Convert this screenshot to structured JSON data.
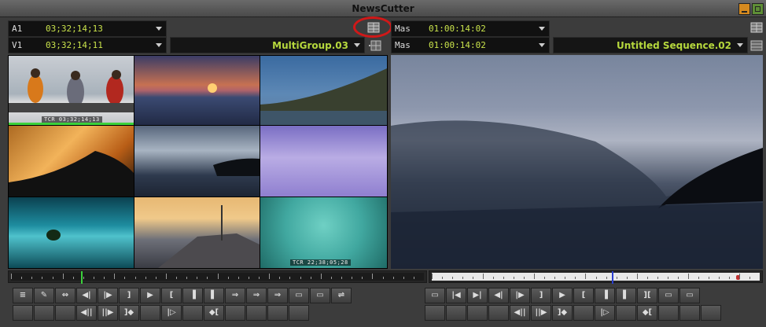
{
  "window": {
    "title": "NewsCutter"
  },
  "source": {
    "track_a": {
      "label": "A1",
      "timecode": "03;32;14;13"
    },
    "track_v": {
      "label": "V1",
      "timecode": "03;32;14;11"
    },
    "clip_name": "MultiGroup.03"
  },
  "record": {
    "track_a": {
      "label": "Mas",
      "timecode": "01:00:14:02"
    },
    "track_v": {
      "label": "Mas",
      "timecode": "01:00:14:02"
    },
    "sequence_name": "Untitled Sequence.02"
  },
  "multicam": {
    "burnins": {
      "cell1": "TCR 03;32;14;13",
      "cell9": "TCR 22;38;05;28"
    }
  },
  "source_position": 0.17,
  "record_position": 0.55,
  "controls": {
    "row1_left": [
      "≡",
      "✎",
      "⇔",
      "◀|",
      "|▶",
      "]",
      "▶",
      "[",
      "▐",
      "▌",
      "⇒",
      "⇒",
      "⇒",
      "▭",
      "▭",
      "⇌"
    ],
    "row2_left": [
      "",
      "",
      "",
      "◀||",
      "||▶",
      "]◆",
      "",
      "|▷",
      "",
      "◆[",
      "",
      "",
      "",
      ""
    ],
    "row1_right": [
      "▭",
      "|◀",
      "▶|",
      "◀|",
      "|▶",
      "]",
      "▶",
      "[",
      "▐",
      "▌",
      "][",
      "▭",
      "▭"
    ],
    "row2_right": [
      "",
      "",
      "",
      "",
      "◀||",
      "||▶",
      "]◆",
      "",
      "|▷",
      "",
      "◆[",
      "",
      "",
      ""
    ]
  },
  "colors": {
    "timecode": "#c9e24b",
    "clip_name": "#b6d83d",
    "highlight_ring": "#d01818"
  }
}
